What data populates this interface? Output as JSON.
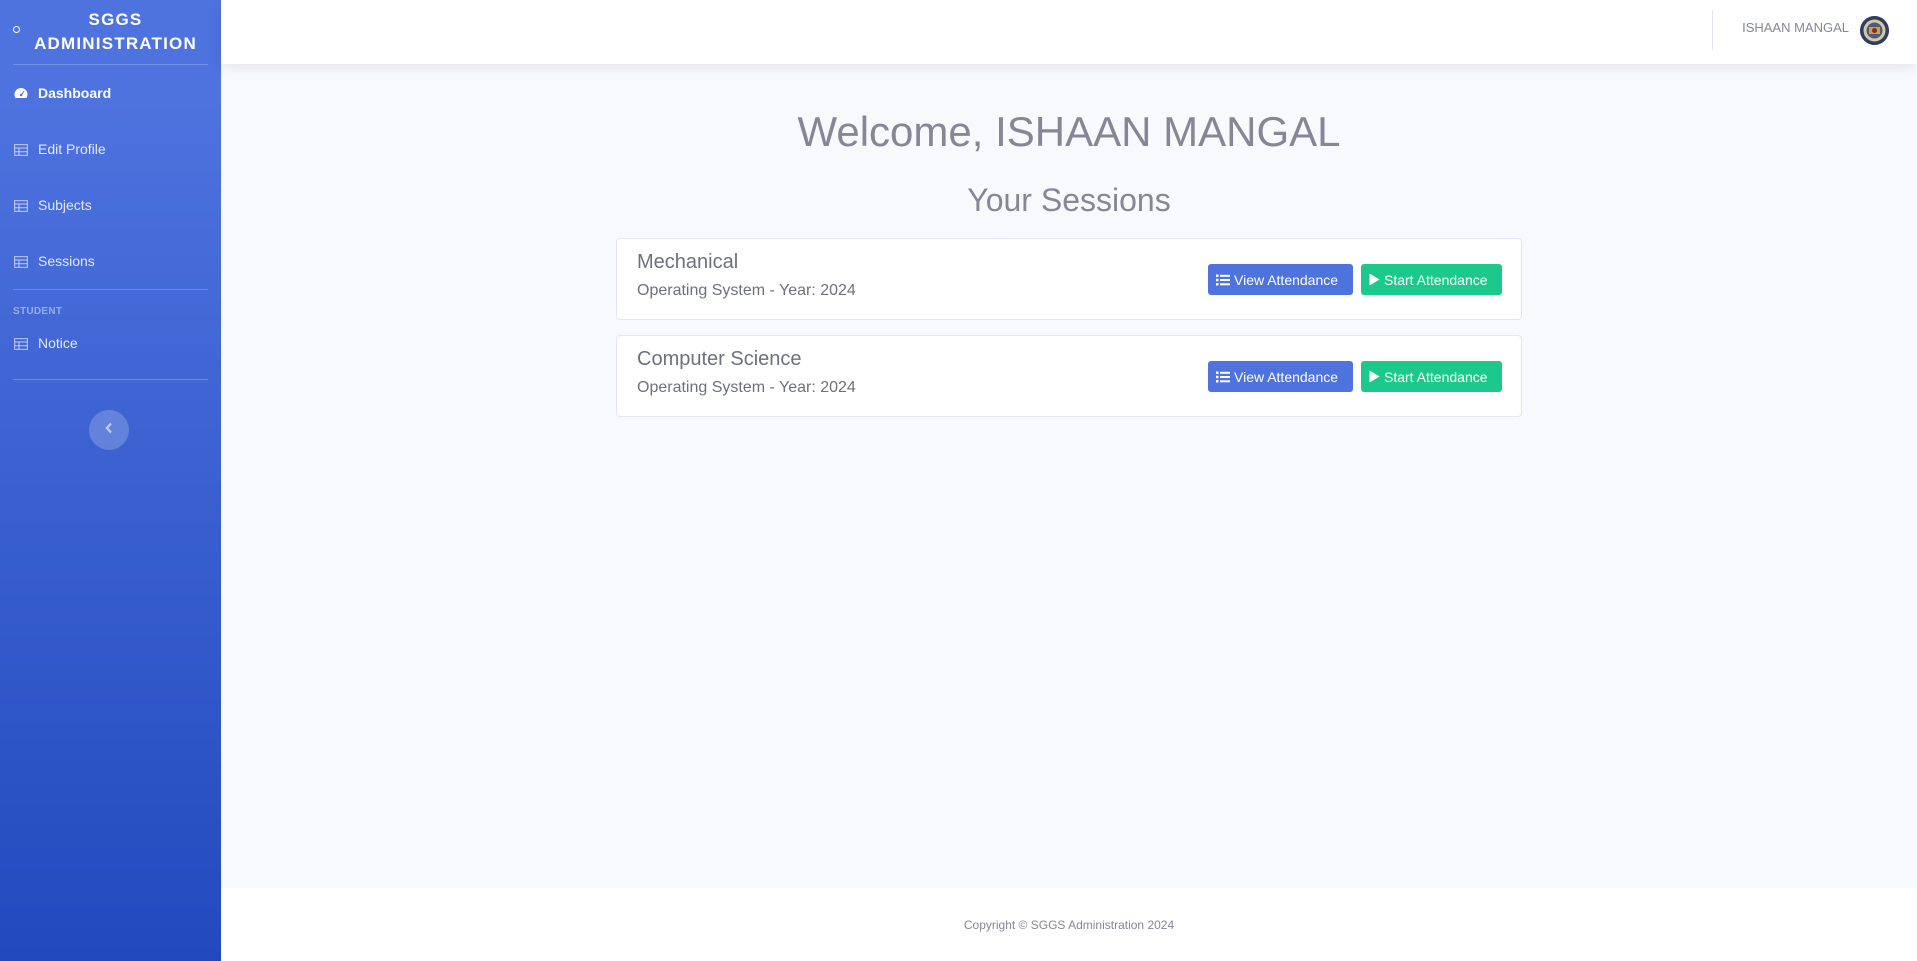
{
  "sidebar": {
    "brand_line1": "SGGS",
    "brand_line2": "ADMINISTRATION",
    "items": [
      {
        "label": "Dashboard",
        "icon": "tachometer-icon",
        "active": true
      },
      {
        "label": "Edit Profile",
        "icon": "table-icon"
      },
      {
        "label": "Subjects",
        "icon": "table-icon"
      },
      {
        "label": "Sessions",
        "icon": "table-icon"
      }
    ],
    "section_heading": "STUDENT",
    "student_items": [
      {
        "label": "Notice",
        "icon": "table-icon"
      }
    ],
    "toggle_icon": "chevron-left-icon"
  },
  "topbar": {
    "user_name": "ISHAAN MANGAL",
    "avatar_icon": "user-avatar"
  },
  "main": {
    "welcome": "Welcome, ISHAAN MANGAL",
    "sessions_title": "Your Sessions",
    "sessions": [
      {
        "course": "Mechanical",
        "subtitle": "Operating System - Year: 2024",
        "view_label": "View Attendance",
        "start_label": "Start Attendance"
      },
      {
        "course": "Computer Science",
        "subtitle": "Operating System - Year: 2024",
        "view_label": "View Attendance",
        "start_label": "Start Attendance"
      }
    ]
  },
  "footer": {
    "copyright": "Copyright © SGGS Administration 2024"
  },
  "colors": {
    "primary": "#4e73df",
    "success": "#1cc88a",
    "text_gray": "#858796"
  }
}
